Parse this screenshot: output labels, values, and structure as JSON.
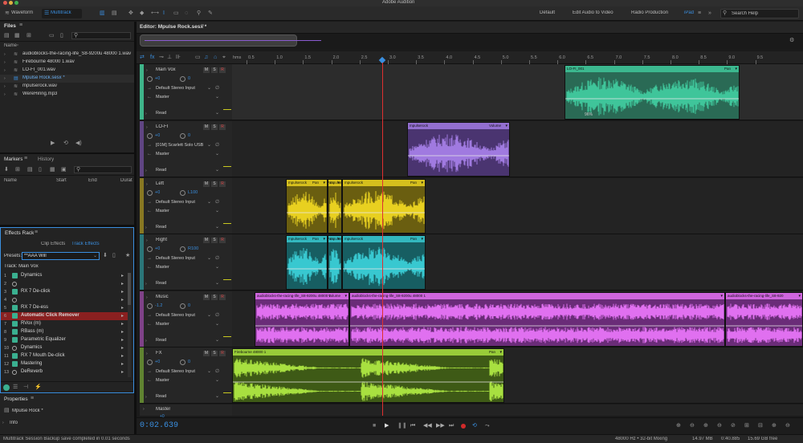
{
  "titlebar": {
    "title": "Adobe Audition",
    "tab_waveform": "Waveform",
    "tab_multitrack": "Multitrack"
  },
  "workspaces": [
    "Default",
    "Edit Audio to Video",
    "Radio Production",
    "iPad"
  ],
  "search": {
    "placeholder": "Search Help"
  },
  "files": {
    "title": "Files",
    "column": "Name",
    "items": [
      {
        "name": "audioblocks-the-racing-life_S8-9200u 48000 1.wav",
        "selected": false
      },
      {
        "name": "Firebourne 48000 1.wav",
        "selected": false
      },
      {
        "name": "LO-FI_001.wav",
        "selected": false
      },
      {
        "name": "Mpulse Rock.sesx *",
        "selected": true
      },
      {
        "name": "mpulserock.wav",
        "selected": false
      },
      {
        "name": "WereHiring.mp3",
        "selected": false
      }
    ]
  },
  "markers": {
    "tab_markers": "Markers",
    "tab_history": "History",
    "col_name": "Name",
    "col_start": "Start",
    "col_end": "End",
    "col_duration": "Durat"
  },
  "effects_rack": {
    "title": "Effects Rack",
    "tab_clip": "Clip Effects",
    "tab_track": "Track Effects",
    "presets_label": "Presets:",
    "preset_value": "**AAA Will",
    "track_label": "Track: Main Vox",
    "effects": [
      {
        "num": "1",
        "name": "Dynamics",
        "on": true,
        "selected": false
      },
      {
        "num": "2",
        "name": "",
        "on": false,
        "selected": false
      },
      {
        "num": "3",
        "name": "RX 7 De-click",
        "on": true,
        "selected": false
      },
      {
        "num": "4",
        "name": "",
        "on": false,
        "selected": false
      },
      {
        "num": "5",
        "name": "RX 7 De-ess",
        "on": true,
        "selected": false
      },
      {
        "num": "6",
        "name": "Automatic Click Remover",
        "on": true,
        "selected": true
      },
      {
        "num": "7",
        "name": "RVox (m)",
        "on": true,
        "selected": false
      },
      {
        "num": "8",
        "name": "RBass (m)",
        "on": true,
        "selected": false
      },
      {
        "num": "9",
        "name": "Parametric Equalizer",
        "on": true,
        "selected": false
      },
      {
        "num": "10",
        "name": "Dynamics",
        "on": false,
        "selected": false
      },
      {
        "num": "11",
        "name": "RX 7 Mouth De-click",
        "on": true,
        "selected": false
      },
      {
        "num": "12",
        "name": "Mastering",
        "on": true,
        "selected": false
      },
      {
        "num": "13",
        "name": "DeReverb",
        "on": false,
        "selected": false
      }
    ]
  },
  "properties": {
    "title": "Properties",
    "session": "Mpulse Rock *",
    "info": "Info"
  },
  "editor": {
    "title": "Editor: Mpulse Rock.sesx *"
  },
  "ruler": {
    "unit": "hms",
    "ticks": [
      "0.5",
      "1.0",
      "1.5",
      "2.0",
      "2.5",
      "3.0",
      "3.5",
      "4.0",
      "4.5",
      "5.0",
      "5.5",
      "6.0",
      "6.5",
      "7.0",
      "7.5",
      "8.0",
      "8.5",
      "9.0",
      "9.5"
    ]
  },
  "tracks": [
    {
      "name": "Main Vox",
      "vol": "+0",
      "pan": "0",
      "input": "Default Stereo Input",
      "output": "Master",
      "mode": "Read",
      "color": "#3fb58a"
    },
    {
      "name": "LO-FI",
      "vol": "+0",
      "pan": "0",
      "input": "[01M] Scarlett Solo USB",
      "output": "Master",
      "mode": "Read",
      "color": "#8f5fd0"
    },
    {
      "name": "Left",
      "vol": "+0",
      "pan": "L100",
      "input": "Default Stereo Input",
      "output": "Master",
      "mode": "Read",
      "color": "#d8bc1f"
    },
    {
      "name": "Right",
      "vol": "+0",
      "pan": "R100",
      "input": "Default Stereo Input",
      "output": "Master",
      "mode": "Read",
      "color": "#2fb8bd"
    },
    {
      "name": "Music",
      "vol": "-1.2",
      "pan": "0",
      "input": "Default Stereo Input",
      "output": "Master",
      "mode": "Read",
      "color": "#c85ad8"
    },
    {
      "name": "FX",
      "vol": "+0",
      "pan": "0",
      "input": "Default Stereo Input",
      "output": "Master",
      "mode": "Read",
      "color": "#8fd03a"
    }
  ],
  "master": {
    "name": "Master",
    "vol": "+0"
  },
  "clips": [
    {
      "title": "LO-FI_001",
      "tag": "Pan",
      "extra": "96%"
    },
    {
      "title": "mpulserock",
      "tag": "Volume"
    },
    {
      "title": "mpulserock",
      "tag": "Pan"
    },
    {
      "title": "mpulserock",
      "tag": "Pan"
    },
    {
      "title": "mpulserock",
      "tag": "Pan"
    },
    {
      "title": "mpulserock",
      "tag": "Pan"
    },
    {
      "title": "audioblocks-the-racing-life_S8-9200u 48000 1",
      "tag": "Volume"
    },
    {
      "title": "audioblocks-the-racing-life_S8-9200u 48000 1",
      "tag": ""
    },
    {
      "title": "audioblocks-the-racing-life_S8-920",
      "tag": ""
    },
    {
      "title": "Firebourne 48000 1",
      "tag": "Pan"
    }
  ],
  "transport": {
    "time": "0:02.639"
  },
  "status": {
    "message": "Multitrack Session Backup save completed in 0.01 seconds",
    "format": "48000 Hz • 32-bit Mixing",
    "memory": "14.97 MB",
    "duration": "0:40.885",
    "free": "15.69 GB free"
  },
  "colors": {
    "accent": "#3a8fe0",
    "playhead": "#e03030",
    "selected_effect": "#8a2020"
  }
}
